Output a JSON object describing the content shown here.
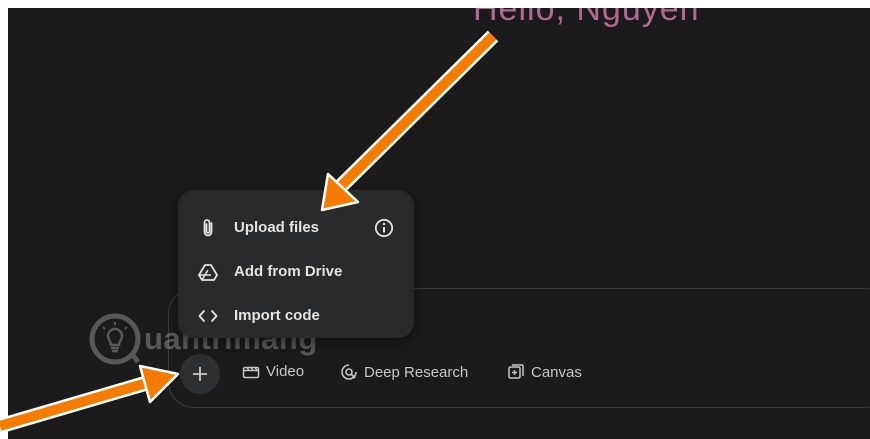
{
  "greeting": "Hello, Nguyen",
  "menu": {
    "items": [
      {
        "label": "Upload files",
        "icon": "paperclip-icon"
      },
      {
        "label": "Add from Drive",
        "icon": "drive-icon"
      },
      {
        "label": "Import code",
        "icon": "code-icon"
      }
    ],
    "info_icon": "info-icon"
  },
  "toolbar": {
    "tools": [
      {
        "label": "Video",
        "icon": "video-icon"
      },
      {
        "label": "Deep Research",
        "icon": "deep-research-icon"
      },
      {
        "label": "Canvas",
        "icon": "canvas-icon"
      }
    ]
  },
  "watermark": "uantrimang",
  "colors": {
    "background": "#1b1b1c",
    "menu": "#282a2c",
    "arrow": "#f57c00",
    "greeting": "#b3688f"
  }
}
